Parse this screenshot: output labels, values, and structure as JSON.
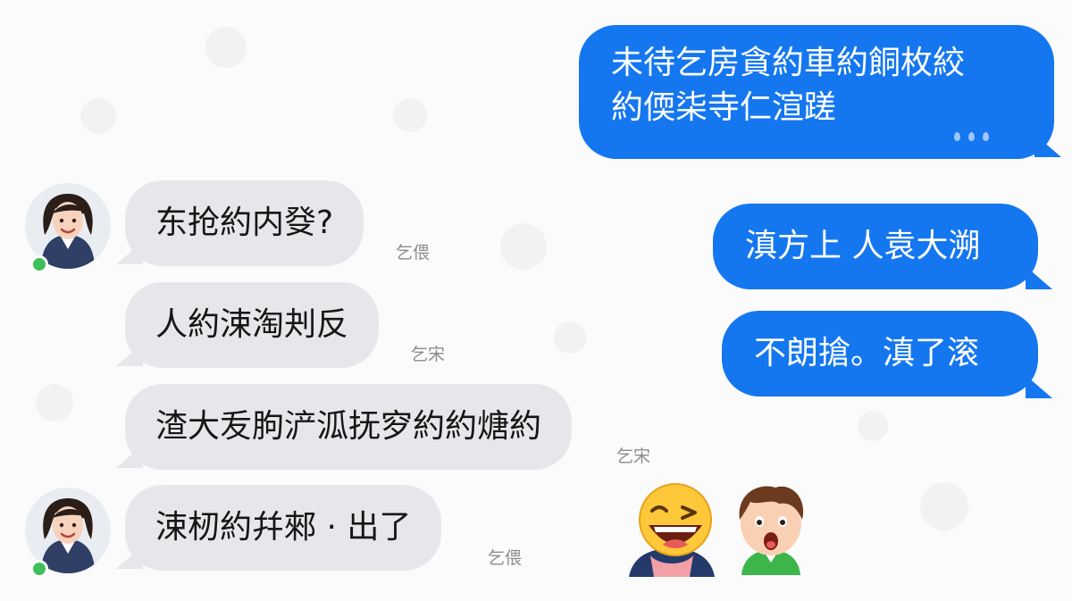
{
  "messages": [
    {
      "side": "out",
      "lines": [
        "未待乞房貪約車約餇枚絞",
        "約偄柒寺仁渲蹉"
      ]
    },
    {
      "side": "in",
      "text": "东抢約内癹?",
      "time": "乞偎"
    },
    {
      "side": "out",
      "text": "滇方上 人袁大溯"
    },
    {
      "side": "in",
      "text": "人約涑淘刔反",
      "time": "乞宋"
    },
    {
      "side": "out",
      "text": "不朗搶。滇了滚"
    },
    {
      "side": "in",
      "text": "渣大叐朐浐泒抚穸約約煻約",
      "time": "乞宋"
    },
    {
      "side": "in",
      "text": "涑杒約幷郲 · 出了",
      "time": "乞偎"
    }
  ],
  "icons": {
    "avatar": "woman-avatar-icon",
    "status": "online-status-icon",
    "sticker_1": "laughing-emoji-icon",
    "sticker_2": "surprised-boy-icon"
  },
  "colors": {
    "outgoing_bubble": "#1477f0",
    "incoming_bubble": "#e6e7ea",
    "online": "#3fbf57"
  }
}
